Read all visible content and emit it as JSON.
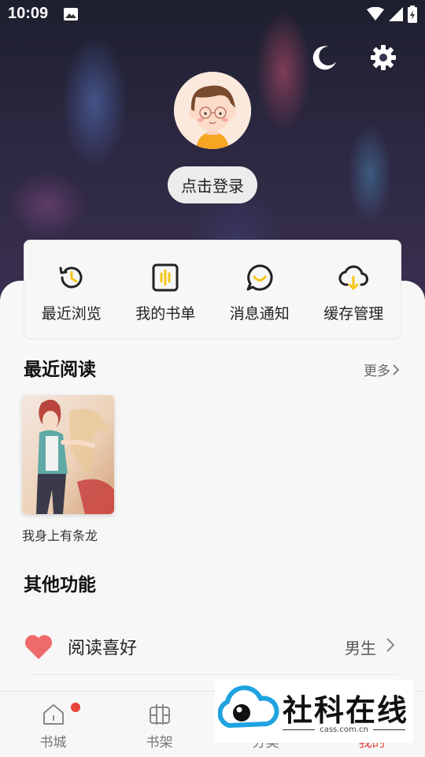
{
  "status_bar": {
    "time": "10:09"
  },
  "header": {
    "login_label": "点击登录"
  },
  "quick_actions": [
    {
      "label": "最近浏览",
      "icon": "history-icon"
    },
    {
      "label": "我的书单",
      "icon": "booklist-icon"
    },
    {
      "label": "消息通知",
      "icon": "message-icon"
    },
    {
      "label": "缓存管理",
      "icon": "cloud-download-icon"
    }
  ],
  "recent": {
    "title": "最近阅读",
    "more_label": "更多",
    "books": [
      {
        "title": "我身上有条龙"
      }
    ]
  },
  "other": {
    "title": "其他功能",
    "preference": {
      "label": "阅读喜好",
      "value": "男生"
    }
  },
  "tabs": [
    {
      "label": "书城",
      "has_badge": true,
      "active": false
    },
    {
      "label": "书架",
      "has_badge": false,
      "active": false
    },
    {
      "label": "分类",
      "has_badge": false,
      "active": false
    },
    {
      "label": "我的",
      "has_badge": false,
      "active": true
    }
  ],
  "watermark": {
    "title": "社科在线",
    "subtitle": "cass.com.cn"
  },
  "colors": {
    "accent": "#e8453c",
    "icon_dark": "#222222",
    "icon_yellow": "#f5c518",
    "heart": "#ef6b6b"
  }
}
